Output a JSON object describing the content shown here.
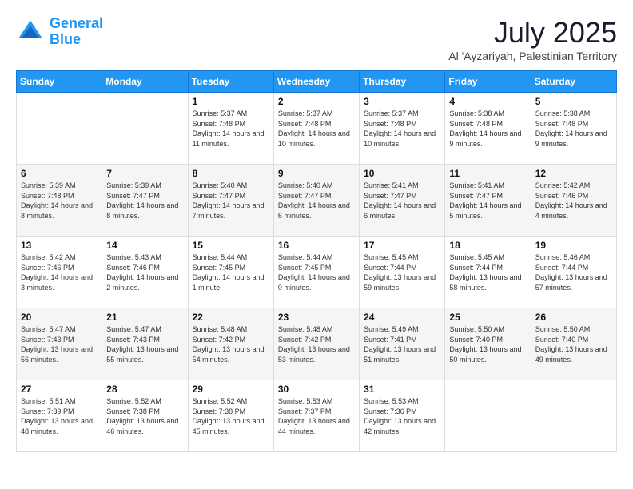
{
  "header": {
    "logo_line1": "General",
    "logo_line2": "Blue",
    "month": "July 2025",
    "location": "Al 'Ayzariyah, Palestinian Territory"
  },
  "weekdays": [
    "Sunday",
    "Monday",
    "Tuesday",
    "Wednesday",
    "Thursday",
    "Friday",
    "Saturday"
  ],
  "weeks": [
    [
      {
        "day": "",
        "sunrise": "",
        "sunset": "",
        "daylight": ""
      },
      {
        "day": "",
        "sunrise": "",
        "sunset": "",
        "daylight": ""
      },
      {
        "day": "1",
        "sunrise": "Sunrise: 5:37 AM",
        "sunset": "Sunset: 7:48 PM",
        "daylight": "Daylight: 14 hours and 11 minutes."
      },
      {
        "day": "2",
        "sunrise": "Sunrise: 5:37 AM",
        "sunset": "Sunset: 7:48 PM",
        "daylight": "Daylight: 14 hours and 10 minutes."
      },
      {
        "day": "3",
        "sunrise": "Sunrise: 5:37 AM",
        "sunset": "Sunset: 7:48 PM",
        "daylight": "Daylight: 14 hours and 10 minutes."
      },
      {
        "day": "4",
        "sunrise": "Sunrise: 5:38 AM",
        "sunset": "Sunset: 7:48 PM",
        "daylight": "Daylight: 14 hours and 9 minutes."
      },
      {
        "day": "5",
        "sunrise": "Sunrise: 5:38 AM",
        "sunset": "Sunset: 7:48 PM",
        "daylight": "Daylight: 14 hours and 9 minutes."
      }
    ],
    [
      {
        "day": "6",
        "sunrise": "Sunrise: 5:39 AM",
        "sunset": "Sunset: 7:48 PM",
        "daylight": "Daylight: 14 hours and 8 minutes."
      },
      {
        "day": "7",
        "sunrise": "Sunrise: 5:39 AM",
        "sunset": "Sunset: 7:47 PM",
        "daylight": "Daylight: 14 hours and 8 minutes."
      },
      {
        "day": "8",
        "sunrise": "Sunrise: 5:40 AM",
        "sunset": "Sunset: 7:47 PM",
        "daylight": "Daylight: 14 hours and 7 minutes."
      },
      {
        "day": "9",
        "sunrise": "Sunrise: 5:40 AM",
        "sunset": "Sunset: 7:47 PM",
        "daylight": "Daylight: 14 hours and 6 minutes."
      },
      {
        "day": "10",
        "sunrise": "Sunrise: 5:41 AM",
        "sunset": "Sunset: 7:47 PM",
        "daylight": "Daylight: 14 hours and 6 minutes."
      },
      {
        "day": "11",
        "sunrise": "Sunrise: 5:41 AM",
        "sunset": "Sunset: 7:47 PM",
        "daylight": "Daylight: 14 hours and 5 minutes."
      },
      {
        "day": "12",
        "sunrise": "Sunrise: 5:42 AM",
        "sunset": "Sunset: 7:46 PM",
        "daylight": "Daylight: 14 hours and 4 minutes."
      }
    ],
    [
      {
        "day": "13",
        "sunrise": "Sunrise: 5:42 AM",
        "sunset": "Sunset: 7:46 PM",
        "daylight": "Daylight: 14 hours and 3 minutes."
      },
      {
        "day": "14",
        "sunrise": "Sunrise: 5:43 AM",
        "sunset": "Sunset: 7:46 PM",
        "daylight": "Daylight: 14 hours and 2 minutes."
      },
      {
        "day": "15",
        "sunrise": "Sunrise: 5:44 AM",
        "sunset": "Sunset: 7:45 PM",
        "daylight": "Daylight: 14 hours and 1 minute."
      },
      {
        "day": "16",
        "sunrise": "Sunrise: 5:44 AM",
        "sunset": "Sunset: 7:45 PM",
        "daylight": "Daylight: 14 hours and 0 minutes."
      },
      {
        "day": "17",
        "sunrise": "Sunrise: 5:45 AM",
        "sunset": "Sunset: 7:44 PM",
        "daylight": "Daylight: 13 hours and 59 minutes."
      },
      {
        "day": "18",
        "sunrise": "Sunrise: 5:45 AM",
        "sunset": "Sunset: 7:44 PM",
        "daylight": "Daylight: 13 hours and 58 minutes."
      },
      {
        "day": "19",
        "sunrise": "Sunrise: 5:46 AM",
        "sunset": "Sunset: 7:44 PM",
        "daylight": "Daylight: 13 hours and 57 minutes."
      }
    ],
    [
      {
        "day": "20",
        "sunrise": "Sunrise: 5:47 AM",
        "sunset": "Sunset: 7:43 PM",
        "daylight": "Daylight: 13 hours and 56 minutes."
      },
      {
        "day": "21",
        "sunrise": "Sunrise: 5:47 AM",
        "sunset": "Sunset: 7:43 PM",
        "daylight": "Daylight: 13 hours and 55 minutes."
      },
      {
        "day": "22",
        "sunrise": "Sunrise: 5:48 AM",
        "sunset": "Sunset: 7:42 PM",
        "daylight": "Daylight: 13 hours and 54 minutes."
      },
      {
        "day": "23",
        "sunrise": "Sunrise: 5:48 AM",
        "sunset": "Sunset: 7:42 PM",
        "daylight": "Daylight: 13 hours and 53 minutes."
      },
      {
        "day": "24",
        "sunrise": "Sunrise: 5:49 AM",
        "sunset": "Sunset: 7:41 PM",
        "daylight": "Daylight: 13 hours and 51 minutes."
      },
      {
        "day": "25",
        "sunrise": "Sunrise: 5:50 AM",
        "sunset": "Sunset: 7:40 PM",
        "daylight": "Daylight: 13 hours and 50 minutes."
      },
      {
        "day": "26",
        "sunrise": "Sunrise: 5:50 AM",
        "sunset": "Sunset: 7:40 PM",
        "daylight": "Daylight: 13 hours and 49 minutes."
      }
    ],
    [
      {
        "day": "27",
        "sunrise": "Sunrise: 5:51 AM",
        "sunset": "Sunset: 7:39 PM",
        "daylight": "Daylight: 13 hours and 48 minutes."
      },
      {
        "day": "28",
        "sunrise": "Sunrise: 5:52 AM",
        "sunset": "Sunset: 7:38 PM",
        "daylight": "Daylight: 13 hours and 46 minutes."
      },
      {
        "day": "29",
        "sunrise": "Sunrise: 5:52 AM",
        "sunset": "Sunset: 7:38 PM",
        "daylight": "Daylight: 13 hours and 45 minutes."
      },
      {
        "day": "30",
        "sunrise": "Sunrise: 5:53 AM",
        "sunset": "Sunset: 7:37 PM",
        "daylight": "Daylight: 13 hours and 44 minutes."
      },
      {
        "day": "31",
        "sunrise": "Sunrise: 5:53 AM",
        "sunset": "Sunset: 7:36 PM",
        "daylight": "Daylight: 13 hours and 42 minutes."
      },
      {
        "day": "",
        "sunrise": "",
        "sunset": "",
        "daylight": ""
      },
      {
        "day": "",
        "sunrise": "",
        "sunset": "",
        "daylight": ""
      }
    ]
  ]
}
